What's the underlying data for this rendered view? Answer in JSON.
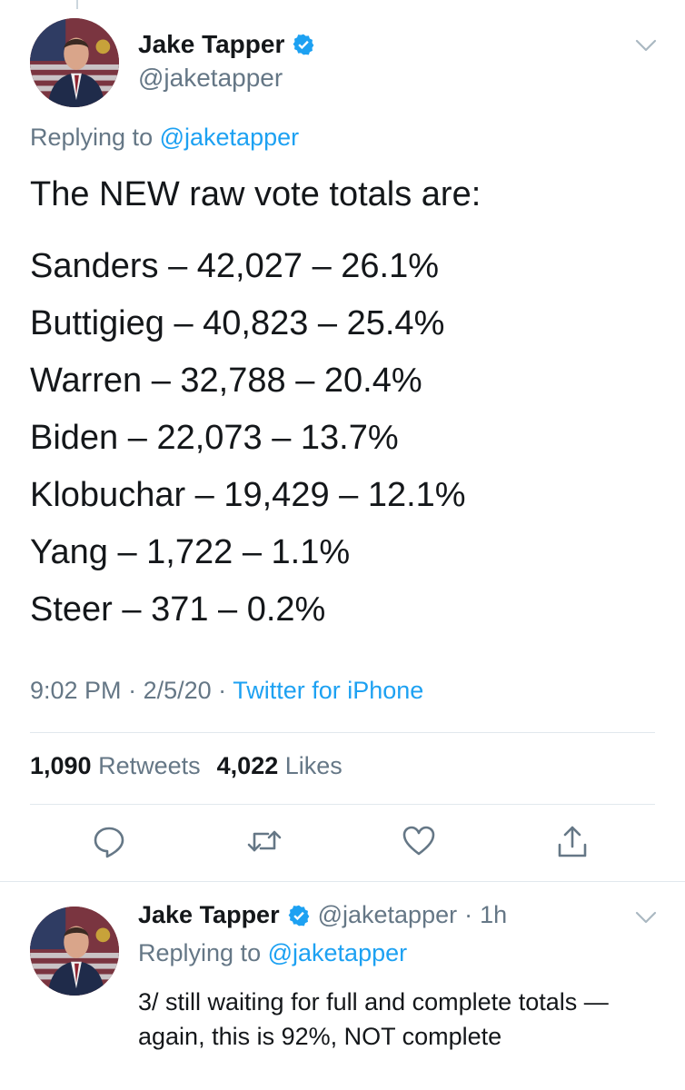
{
  "main_tweet": {
    "author_name": "Jake Tapper",
    "author_handle": "@jaketapper",
    "replying_prefix": "Replying to",
    "replying_handle": "@jaketapper",
    "intro": "The NEW raw vote totals are:",
    "votes": [
      "Sanders – 42,027 – 26.1%",
      "Buttigieg – 40,823 – 25.4%",
      "Warren – 32,788 – 20.4%",
      "Biden – 22,073 – 13.7%",
      "Klobuchar – 19,429 – 12.1%",
      "Yang – 1,722 – 1.1%",
      "Steer – 371 – 0.2%"
    ],
    "time": "9:02 PM",
    "date": "2/5/20",
    "source": "Twitter for iPhone",
    "retweet_count": "1,090",
    "retweet_label": "Retweets",
    "like_count": "4,022",
    "like_label": "Likes"
  },
  "reply_tweet": {
    "author_name": "Jake Tapper",
    "author_handle": "@jaketapper",
    "age": "1h",
    "replying_prefix": "Replying to",
    "replying_handle": "@jaketapper",
    "text": "3/ still waiting for full and complete totals — again, this is 92%, NOT complete"
  },
  "icons": {
    "verified": "verified-badge-icon",
    "more": "chevron-down-icon",
    "reply": "reply-icon",
    "retweet": "retweet-icon",
    "like": "heart-icon",
    "share": "share-icon"
  },
  "colors": {
    "link": "#1da1f2",
    "secondary_text": "#657786",
    "primary_text": "#14171a",
    "divider": "#e1e8ed"
  }
}
